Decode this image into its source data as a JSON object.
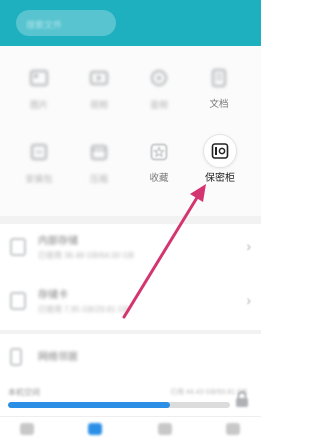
{
  "header": {
    "search_placeholder": "搜索文件"
  },
  "categories": [
    {
      "label": "图片"
    },
    {
      "label": "视频"
    },
    {
      "label": "音频"
    },
    {
      "label": "文档"
    },
    {
      "label": "安装包"
    },
    {
      "label": "压缩"
    },
    {
      "label": "收藏"
    },
    {
      "label": "保密柜"
    }
  ],
  "storage_rows": [
    {
      "title": "内部存储",
      "subtitle": "已使用 36.48 GB/64.00 GB"
    },
    {
      "title": "存储卡",
      "subtitle": "已使用 7.95 GB/29.81 GB"
    },
    {
      "title": "网络邻居",
      "subtitle": ""
    }
  ],
  "storage_summary": {
    "label": "本机空间",
    "value": "已用 44.43 GB/93.81 GB",
    "used_fraction": 0.73
  },
  "colors": {
    "header": "#1fb0c0",
    "accent": "#2c8fe6",
    "arrow": "#d4346f"
  }
}
